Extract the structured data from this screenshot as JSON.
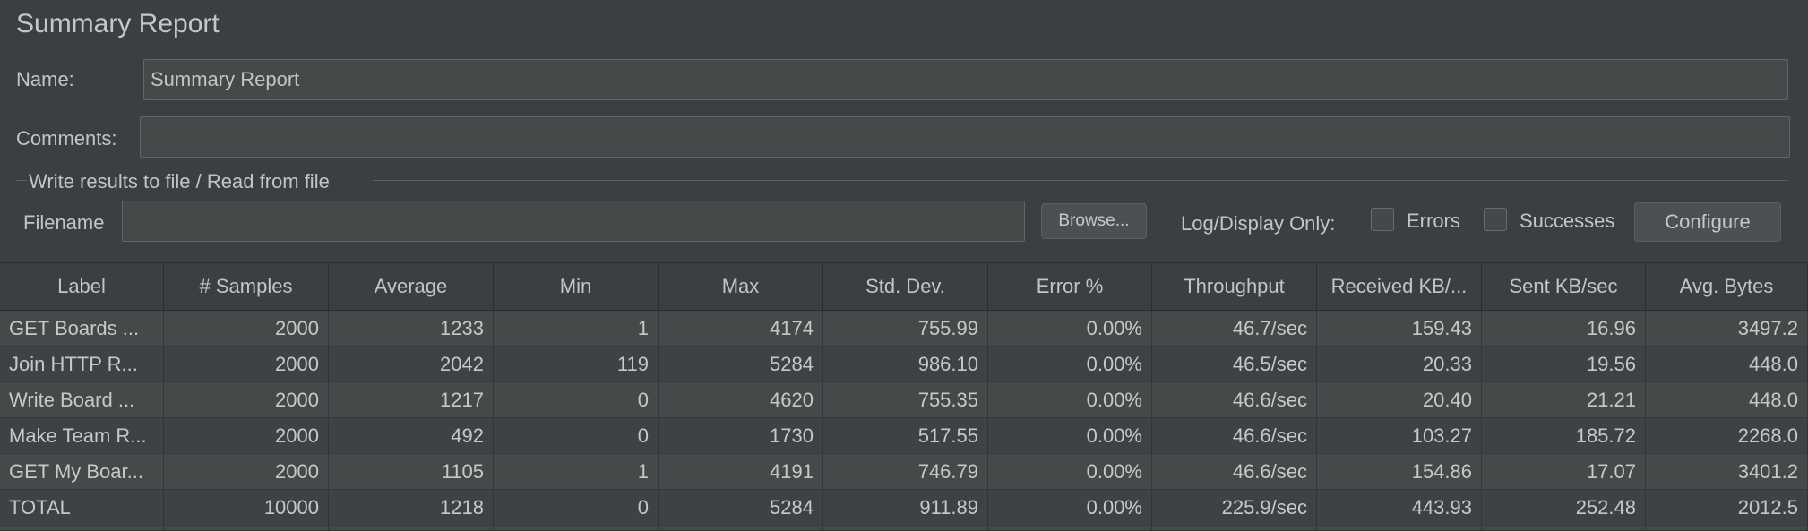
{
  "panel": {
    "title": "Summary Report",
    "name_label": "Name:",
    "name_value": "Summary Report",
    "comments_label": "Comments:",
    "comments_value": ""
  },
  "file_section": {
    "legend": "Write results to file / Read from file",
    "filename_label": "Filename",
    "filename_value": "",
    "browse_label": "Browse...",
    "log_label": "Log/Display Only:",
    "errors_label": "Errors",
    "errors_checked": false,
    "successes_label": "Successes",
    "successes_checked": false,
    "configure_label": "Configure"
  },
  "table": {
    "columns": [
      "Label",
      "# Samples",
      "Average",
      "Min",
      "Max",
      "Std. Dev.",
      "Error %",
      "Throughput",
      "Received KB/...",
      "Sent KB/sec",
      "Avg. Bytes"
    ],
    "rows": [
      [
        "GET Boards ...",
        "2000",
        "1233",
        "1",
        "4174",
        "755.99",
        "0.00%",
        "46.7/sec",
        "159.43",
        "16.96",
        "3497.2"
      ],
      [
        "Join HTTP R...",
        "2000",
        "2042",
        "119",
        "5284",
        "986.10",
        "0.00%",
        "46.5/sec",
        "20.33",
        "19.56",
        "448.0"
      ],
      [
        "Write Board ...",
        "2000",
        "1217",
        "0",
        "4620",
        "755.35",
        "0.00%",
        "46.6/sec",
        "20.40",
        "21.21",
        "448.0"
      ],
      [
        "Make Team R...",
        "2000",
        "492",
        "0",
        "1730",
        "517.55",
        "0.00%",
        "46.6/sec",
        "103.27",
        "185.72",
        "2268.0"
      ],
      [
        "GET My Boar...",
        "2000",
        "1105",
        "1",
        "4191",
        "746.79",
        "0.00%",
        "46.6/sec",
        "154.86",
        "17.07",
        "3401.2"
      ],
      [
        "TOTAL",
        "10000",
        "1218",
        "0",
        "5284",
        "911.89",
        "0.00%",
        "225.9/sec",
        "443.93",
        "252.48",
        "2012.5"
      ]
    ]
  }
}
